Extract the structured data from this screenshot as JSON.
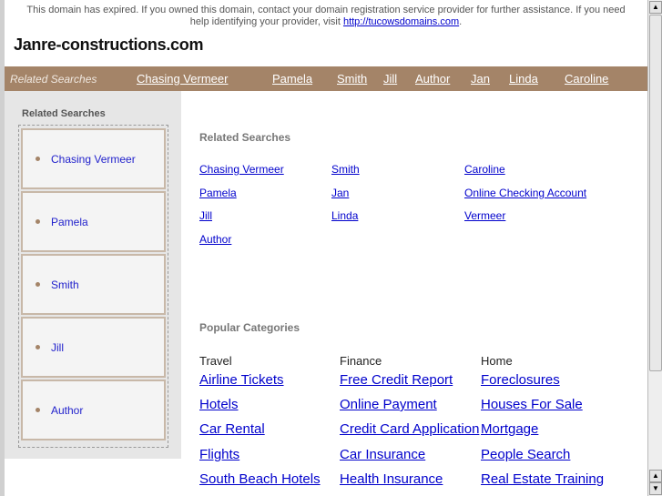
{
  "notice": {
    "text": "This domain has expired. If you owned this domain, contact your domain registration service provider for further assistance. If you need help identifying your provider, visit ",
    "link": "http://tucowsdomains.com",
    "end": "."
  },
  "site_title": "Janre-constructions.com",
  "topbar": {
    "label": "Related Searches",
    "links": [
      "Chasing Vermeer",
      "Pamela",
      "Smith",
      "Jill",
      "Author",
      "Jan",
      "Linda",
      "Caroline"
    ]
  },
  "sidebar": {
    "title": "Related Searches",
    "items": [
      "Chasing Vermeer",
      "Pamela",
      "Smith",
      "Jill",
      "Author"
    ]
  },
  "related": {
    "title": "Related Searches",
    "columns": [
      [
        "Chasing Vermeer",
        "Pamela",
        "Jill",
        "Author"
      ],
      [
        "Smith",
        "Jan",
        "Linda"
      ],
      [
        "Caroline",
        "Online Checking Account",
        "Vermeer"
      ]
    ]
  },
  "popular": {
    "title": "Popular Categories",
    "categories": [
      {
        "name": "Travel",
        "links": [
          "Airline Tickets",
          "Hotels",
          "Car Rental",
          "Flights",
          "South Beach Hotels"
        ]
      },
      {
        "name": "Finance",
        "links": [
          "Free Credit Report",
          "Online Payment",
          "Credit Card Application",
          "Car Insurance",
          "Health Insurance"
        ]
      },
      {
        "name": "Home",
        "links": [
          "Foreclosures",
          "Houses For Sale",
          "Mortgage",
          "People Search",
          "Real Estate Training"
        ]
      }
    ]
  }
}
